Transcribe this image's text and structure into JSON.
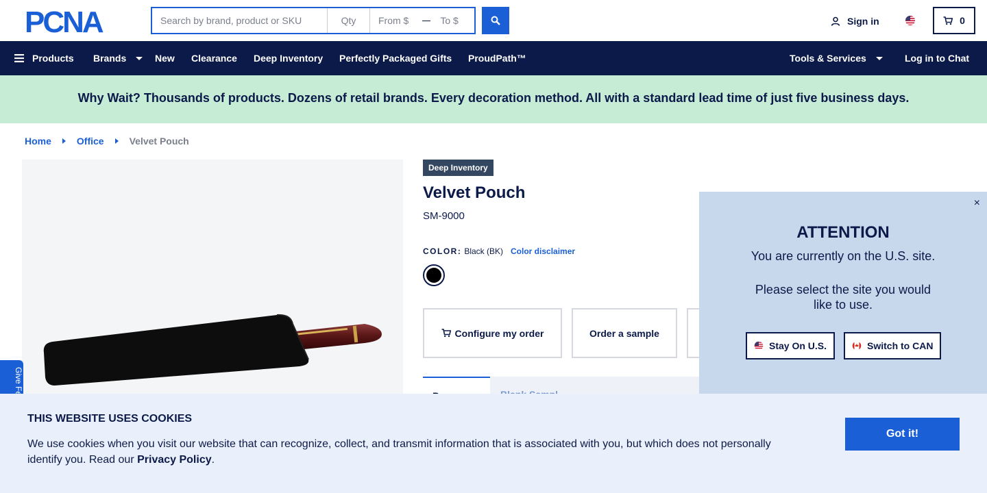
{
  "header": {
    "logo_text": "PCNA",
    "search": {
      "keyword_placeholder": "Search by brand, product or SKU",
      "qty_placeholder": "Qty",
      "price_from_placeholder": "From $",
      "price_to_placeholder": "To $"
    },
    "sign_in": "Sign in",
    "cart_count": "0"
  },
  "nav": {
    "products": "Products",
    "brands": "Brands",
    "new": "New",
    "clearance": "Clearance",
    "deep_inventory": "Deep Inventory",
    "gifts": "Perfectly Packaged Gifts",
    "proudpath": "ProudPath™",
    "tools": "Tools & Services",
    "chat": "Log in to Chat"
  },
  "promo": "Why Wait? Thousands of products. Dozens of retail brands. Every decoration method. All with a standard lead time of just five business days.",
  "breadcrumb": [
    "Home",
    "Office",
    "Velvet Pouch"
  ],
  "product": {
    "badge": "Deep Inventory",
    "title": "Velvet Pouch",
    "sku": "SM-9000",
    "color_label": "COLOR:",
    "color_value": "Black (BK)",
    "color_disclaimer": "Color disclaimer",
    "swatch_color": "#000000",
    "configure": "Configure my order",
    "sample": "Order a sample",
    "tab_active": "Prom",
    "tab_blank": "Blank",
    "tab_blank_fragment": "Blank   Sampl"
  },
  "feedback": "Give Fe",
  "modal": {
    "close": "×",
    "title": "ATTENTION",
    "line1": "You are currently on the U.S. site.",
    "line2": "Please select the site you would like to use.",
    "stay": "Stay On U.S.",
    "switch": "Switch to CAN"
  },
  "cookie": {
    "title": "THIS WEBSITE USES COOKIES",
    "body_pre": "We use cookies when you visit our website that can recognize, collect, and transmit information that is associated with you, but which does not personally identify you. Read our ",
    "link": "Privacy Policy",
    "body_post": ".",
    "button": "Got it!"
  },
  "colors": {
    "navy": "#0b1a48",
    "blue": "#1a5fd6",
    "promo_bg": "#c6ecd6",
    "modal_bg": "#c8d8ec",
    "cookie_bg": "#eaf0fb"
  }
}
